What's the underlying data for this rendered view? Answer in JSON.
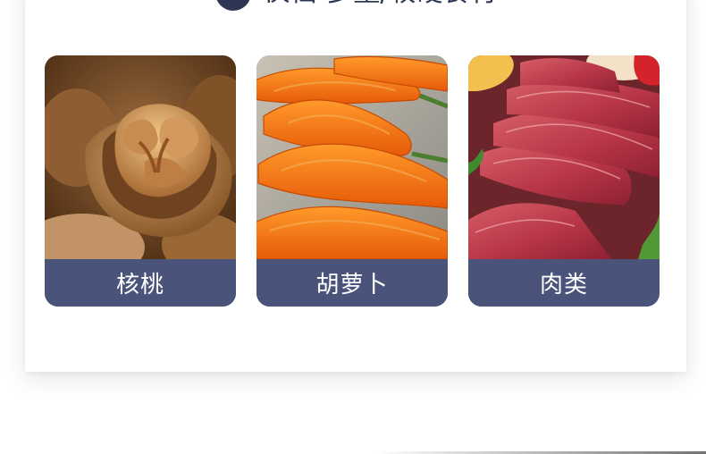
{
  "section": {
    "title": "伙档-多量/较硬食材"
  },
  "items": [
    {
      "label": "核桃",
      "icon": "walnut-photo"
    },
    {
      "label": "胡萝卜",
      "icon": "carrot-photo"
    },
    {
      "label": "肉类",
      "icon": "meat-photo"
    }
  ],
  "colors": {
    "accent": "#4a547b",
    "heading": "#2e3654"
  }
}
